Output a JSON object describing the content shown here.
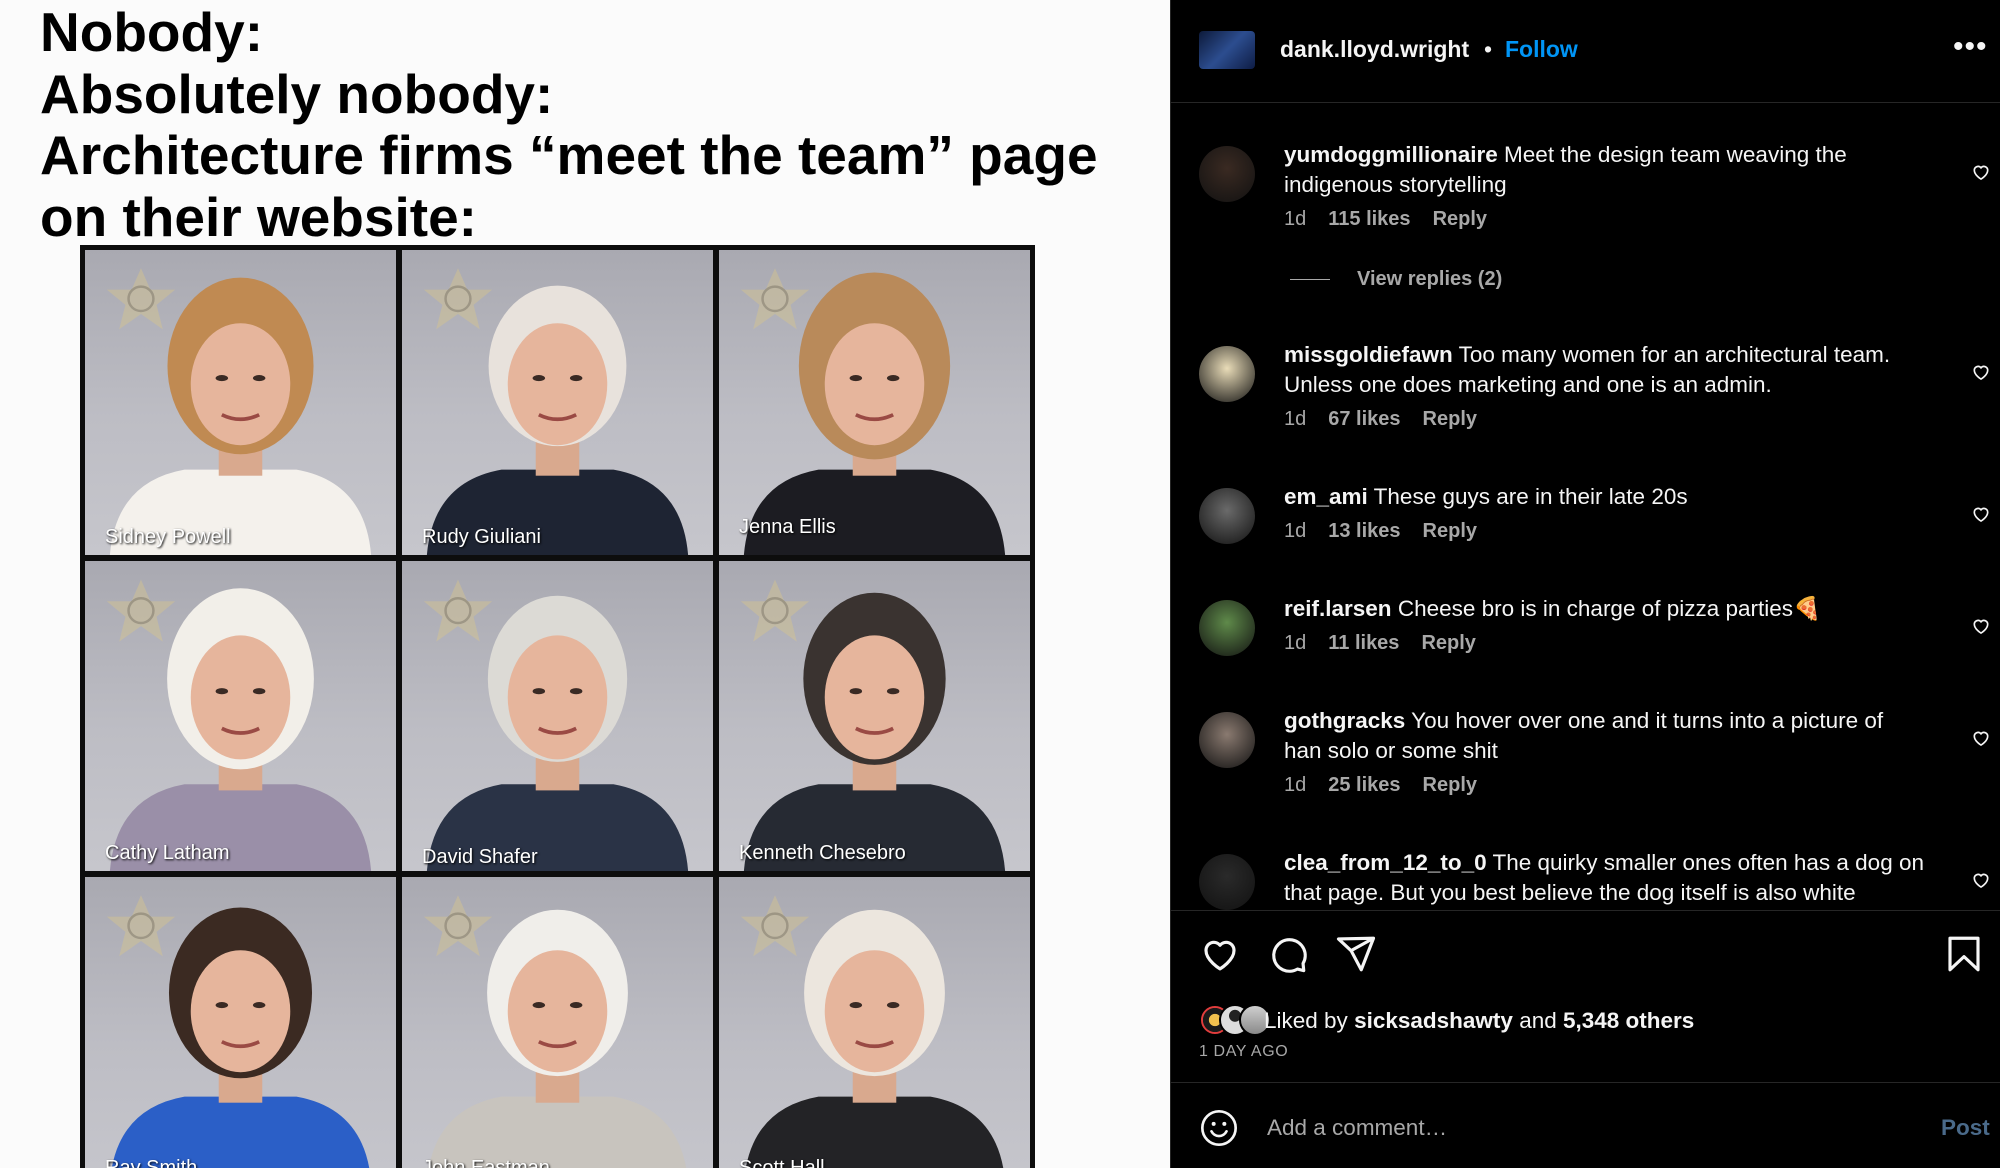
{
  "meme": {
    "lines": [
      "Nobody:",
      "Absolutely nobody:",
      "Architecture firms “meet the team” page",
      "on their website:"
    ],
    "mugshots": [
      {
        "name": "Sidney Powell"
      },
      {
        "name": "Rudy Giuliani"
      },
      {
        "name": "Jenna Ellis"
      },
      {
        "name": "Cathy Latham"
      },
      {
        "name": "David Shafer"
      },
      {
        "name": "Kenneth Chesebro"
      },
      {
        "name": "Ray Smith"
      },
      {
        "name": "John Eastman"
      },
      {
        "name": "Scott Hall"
      }
    ]
  },
  "post": {
    "username": "dank.lloyd.wright",
    "separator": "•",
    "follow_label": "Follow",
    "more_label": "•••"
  },
  "comments": [
    {
      "user": "yumdoggmillionaire",
      "text": "Meet the design team weaving the indigenous storytelling",
      "time": "1d",
      "likes": "115 likes",
      "reply": "Reply",
      "avatar_color": "#3a2a22",
      "view_replies": "View replies (2)"
    },
    {
      "user": "missgoldiefawn",
      "text": "Too many women for an architectural team. Unless one does marketing and one is an admin.",
      "time": "1d",
      "likes": "67 likes",
      "reply": "Reply",
      "avatar_color": "#e9dcb8"
    },
    {
      "user": "em_ami",
      "text": "These guys are in their late 20s",
      "time": "1d",
      "likes": "13 likes",
      "reply": "Reply",
      "avatar_color": "#6a6a6a"
    },
    {
      "user": "reif.larsen",
      "text": "Cheese bro is in charge of pizza parties🍕",
      "time": "1d",
      "likes": "11 likes",
      "reply": "Reply",
      "avatar_color": "#5f8a4a"
    },
    {
      "user": "gothgracks",
      "text": "You hover over one and it turns into a picture of han solo or some shit",
      "time": "1d",
      "likes": "25 likes",
      "reply": "Reply",
      "avatar_color": "#8a7a70"
    },
    {
      "user": "clea_from_12_to_0",
      "text": "The quirky smaller ones often has a dog on that page. But you best believe the dog itself is also white",
      "time": "",
      "likes": "",
      "reply": "",
      "avatar_color": "#2a2a2a"
    }
  ],
  "actions": {
    "icons": [
      "heart-icon",
      "comment-icon",
      "share-icon",
      "bookmark-icon"
    ],
    "liked_by_prefix": "Liked by",
    "liked_by_user": "sicksadshawty",
    "liked_by_and": "and",
    "liked_by_others": "5,348 others",
    "time_ago": "1 DAY AGO"
  },
  "add_comment": {
    "placeholder": "Add a comment…",
    "post_label": "Post"
  },
  "colors": {
    "follow": "#0095f6",
    "post_disabled": "#4a6a8a",
    "muted": "#a8a8a8"
  }
}
